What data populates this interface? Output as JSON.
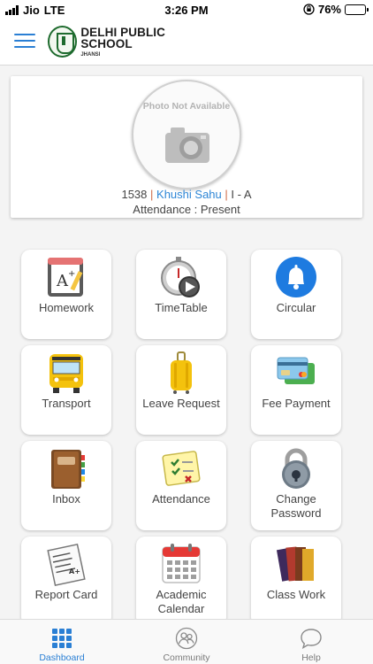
{
  "status_bar": {
    "carrier": "Jio",
    "network": "LTE",
    "time": "3:26 PM",
    "battery": "76%",
    "battery_level": 0.76,
    "battery_color": "#f6c400"
  },
  "header": {
    "menu_icon": "hamburger-icon",
    "school_name": "DELHI PUBLIC SCHOOL",
    "school_city": "JHANSI",
    "accent_color": "#2a7fd4"
  },
  "profile": {
    "photo_placeholder": "Photo Not Available",
    "roll_number": "1538",
    "separator": "|",
    "student_name": "Khushi Sahu",
    "class_section": "I - A",
    "attendance_text": "Attendance : Present"
  },
  "tiles": [
    {
      "label": "Homework",
      "icon": "homework-notebook-icon"
    },
    {
      "label": "TimeTable",
      "icon": "stopwatch-play-icon"
    },
    {
      "label": "Circular",
      "icon": "bell-icon"
    },
    {
      "label": "Transport",
      "icon": "school-bus-icon"
    },
    {
      "label": "Leave Request",
      "icon": "suitcase-icon"
    },
    {
      "label": "Fee Payment",
      "icon": "credit-cards-icon"
    },
    {
      "label": "Inbox",
      "icon": "address-book-icon"
    },
    {
      "label": "Attendance",
      "icon": "checklist-icon"
    },
    {
      "label": "Change Password",
      "icon": "padlock-icon"
    },
    {
      "label": "Report Card",
      "icon": "report-sheet-icon"
    },
    {
      "label": "Academic Calendar",
      "icon": "calendar-icon"
    },
    {
      "label": "Class Work",
      "icon": "books-icon"
    }
  ],
  "bottom_nav": [
    {
      "label": "Dashboard",
      "icon": "grid-icon",
      "active": true
    },
    {
      "label": "Community",
      "icon": "community-icon",
      "active": false
    },
    {
      "label": "Help",
      "icon": "chat-bubble-icon",
      "active": false
    }
  ]
}
